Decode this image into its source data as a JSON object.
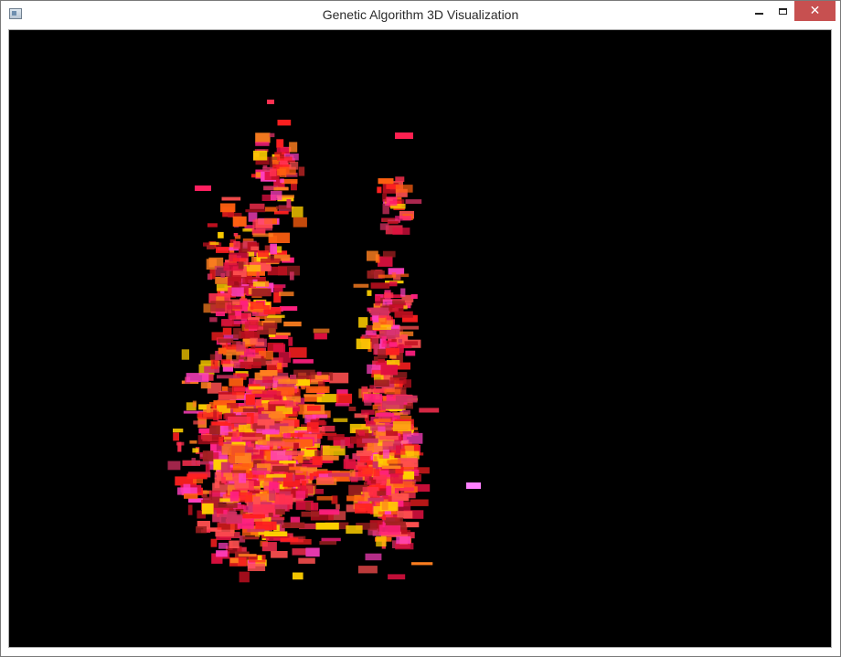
{
  "window": {
    "title": "Genetic Algorithm 3D Visualization",
    "controls": {
      "minimize": "minimize",
      "maximize": "maximize",
      "close": "close"
    }
  },
  "viewport": {
    "background": "#000000",
    "content": "population-point-cloud",
    "palette": [
      "#ff2020",
      "#e01040",
      "#ff3050",
      "#ff6010",
      "#ff8020",
      "#c01020",
      "#ff2080",
      "#ff40c0",
      "#ffd000",
      "#a02020",
      "#ff5050",
      "#d03060"
    ]
  }
}
